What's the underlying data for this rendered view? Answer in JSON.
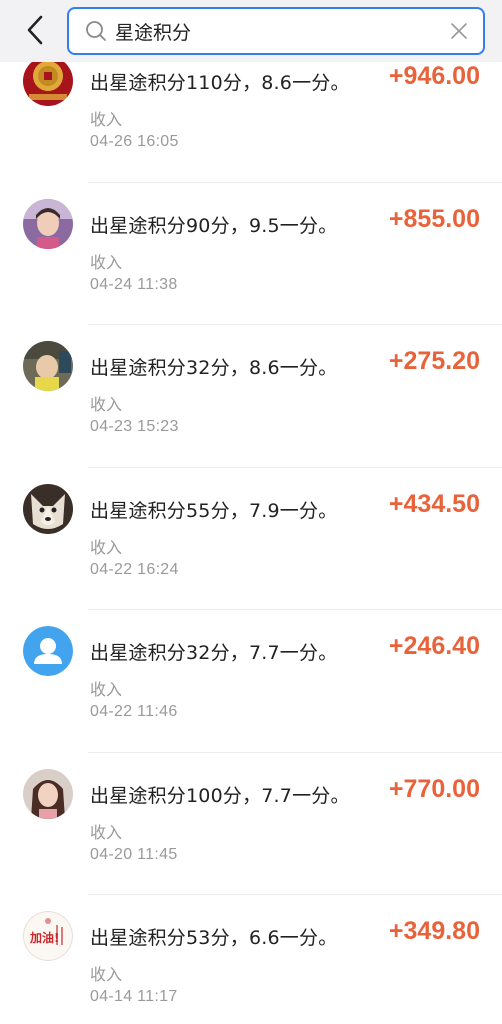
{
  "search": {
    "value": "星途积分",
    "accent_color": "#2f7ff0"
  },
  "transactions": [
    {
      "title": "出星途积分110分，8.6一分。",
      "type": "收入",
      "time": "04-26 16:05",
      "amount": "+946.00",
      "avatar": "gold-coin-avatar"
    },
    {
      "title": "出星途积分90分，9.5一分。",
      "type": "收入",
      "time": "04-24 11:38",
      "amount": "+855.00",
      "avatar": "child-photo-avatar"
    },
    {
      "title": "出星途积分32分，8.6一分。",
      "type": "收入",
      "time": "04-23 15:23",
      "amount": "+275.20",
      "avatar": "baby-photo-avatar"
    },
    {
      "title": "出星途积分55分，7.9一分。",
      "type": "收入",
      "time": "04-22 16:24",
      "amount": "+434.50",
      "avatar": "dog-avatar"
    },
    {
      "title": "出星途积分32分，7.7一分。",
      "type": "收入",
      "time": "04-22 11:46",
      "amount": "+246.40",
      "avatar": "default-user-avatar"
    },
    {
      "title": "出星途积分100分，7.7一分。",
      "type": "收入",
      "time": "04-20 11:45",
      "amount": "+770.00",
      "avatar": "girl-photo-avatar"
    },
    {
      "title": "出星途积分53分，6.6一分。",
      "type": "收入",
      "time": "04-14 11:17",
      "amount": "+349.80",
      "avatar": "jiayou-sticker-avatar"
    }
  ],
  "colors": {
    "amount": "#e8623a",
    "secondary_text": "#9a9a9a",
    "header_bg": "#f2f2f4"
  },
  "avatar_texts": {
    "jiayou": "加油!"
  }
}
